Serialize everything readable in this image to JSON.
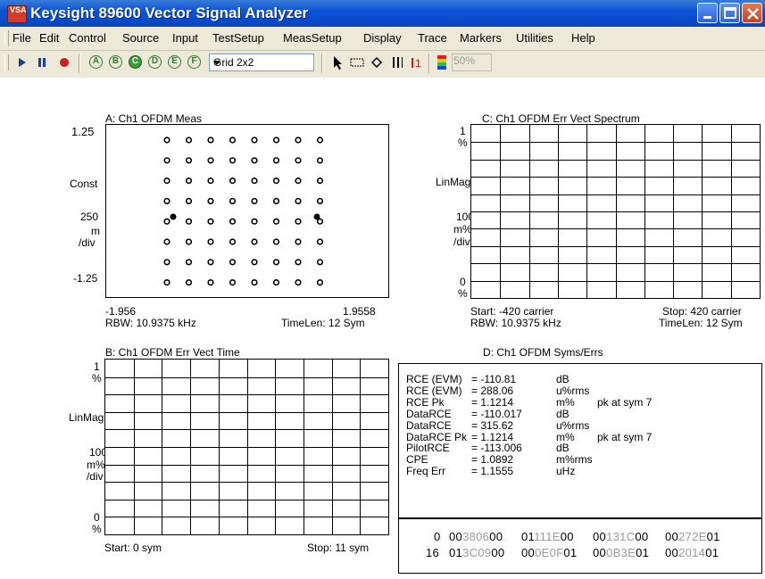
{
  "window": {
    "title": "Keysight 89600 Vector Signal Analyzer",
    "icon_text": "VSA"
  },
  "menu": [
    "File",
    "Edit",
    "Control",
    "Source",
    "Input",
    "TestSetup",
    "MeasSetup",
    "Display",
    "Trace",
    "Markers",
    "Utilities",
    "Help"
  ],
  "toolbar": {
    "trace_buttons": [
      "A",
      "B",
      "C",
      "D",
      "E",
      "F"
    ],
    "selected_trace": "C",
    "layout_select": "Grid 2x2",
    "zoom_value": "50%"
  },
  "colors": {
    "accent": "#0a54d8",
    "trace_green": "#2d7d2d",
    "grid": "#000000"
  },
  "trace_a": {
    "title": "A: Ch1 OFDM Meas",
    "y_top": "1.25",
    "y_format": "Const",
    "y_scale_1": "250",
    "y_scale_2": "m",
    "y_scale_3": "/div",
    "y_bottom": "-1.25",
    "x_left": "-1.956",
    "x_right": "1.9558",
    "rbw": "RBW: 10.9375 kHz",
    "timelen": "TimeLen: 12 Sym"
  },
  "trace_b": {
    "title": "B: Ch1 OFDM Err Vect Time",
    "y_top": "1",
    "y_top_unit": "%",
    "y_format": "LinMag",
    "y_scale_1": "100",
    "y_scale_2": "m%",
    "y_scale_3": "/div",
    "y_bottom": "0",
    "y_bottom_unit": "%",
    "start": "Start: 0  sym",
    "stop": "Stop: 11  sym"
  },
  "trace_c": {
    "title": "C: Ch1 OFDM Err Vect Spectrum",
    "y_top": "1",
    "y_top_unit": "%",
    "y_format": "LinMag",
    "y_scale_1": "100",
    "y_scale_2": "m%",
    "y_scale_3": "/div",
    "y_bottom": "0",
    "y_bottom_unit": "%",
    "start": "Start: -420  carrier",
    "stop": "Stop: 420  carrier",
    "rbw": "RBW: 10.9375 kHz",
    "timelen": "TimeLen: 12  Sym"
  },
  "trace_d": {
    "title": "D: Ch1 OFDM Syms/Errs",
    "rows": [
      {
        "name": "RCE (EVM)",
        "value": "= -110.81",
        "unit": "dB",
        "extra": ""
      },
      {
        "name": "RCE (EVM)",
        "value": "= 288.06",
        "unit": "u%rms",
        "extra": ""
      },
      {
        "name": "RCE Pk",
        "value": "= 1.1214",
        "unit": "m%",
        "extra": "pk  at  sym 7"
      },
      {
        "name": "DataRCE",
        "value": "= -110.017",
        "unit": "dB",
        "extra": ""
      },
      {
        "name": "DataRCE",
        "value": "= 315.62",
        "unit": "u%rms",
        "extra": ""
      },
      {
        "name": "DataRCE Pk",
        "value": "= 1.1214",
        "unit": "m%",
        "extra": "pk  at  sym 7"
      },
      {
        "name": "PilotRCE",
        "value": "= -113.006",
        "unit": "dB",
        "extra": ""
      },
      {
        "name": "CPE",
        "value": "= 1.0892",
        "unit": "m%rms",
        "extra": ""
      },
      {
        "name": "Freq  Err",
        "value": "= 1.1555",
        "unit": "uHz",
        "extra": ""
      }
    ],
    "hex_rows": [
      {
        "index": "0",
        "words": [
          {
            "a": "00",
            "b": "3806",
            "c": "00"
          },
          {
            "a": "01",
            "b": "111E",
            "c": "00"
          },
          {
            "a": "00",
            "b": "131C",
            "c": "00"
          },
          {
            "a": "00",
            "b": "272E",
            "c": "01"
          }
        ]
      },
      {
        "index": "16",
        "words": [
          {
            "a": "01",
            "b": "3C09",
            "c": "00"
          },
          {
            "a": "00",
            "b": "0E0F",
            "c": "01"
          },
          {
            "a": "00",
            "b": "0B3E",
            "c": "01"
          },
          {
            "a": "00",
            "b": "2014",
            "c": "01"
          }
        ]
      }
    ]
  }
}
